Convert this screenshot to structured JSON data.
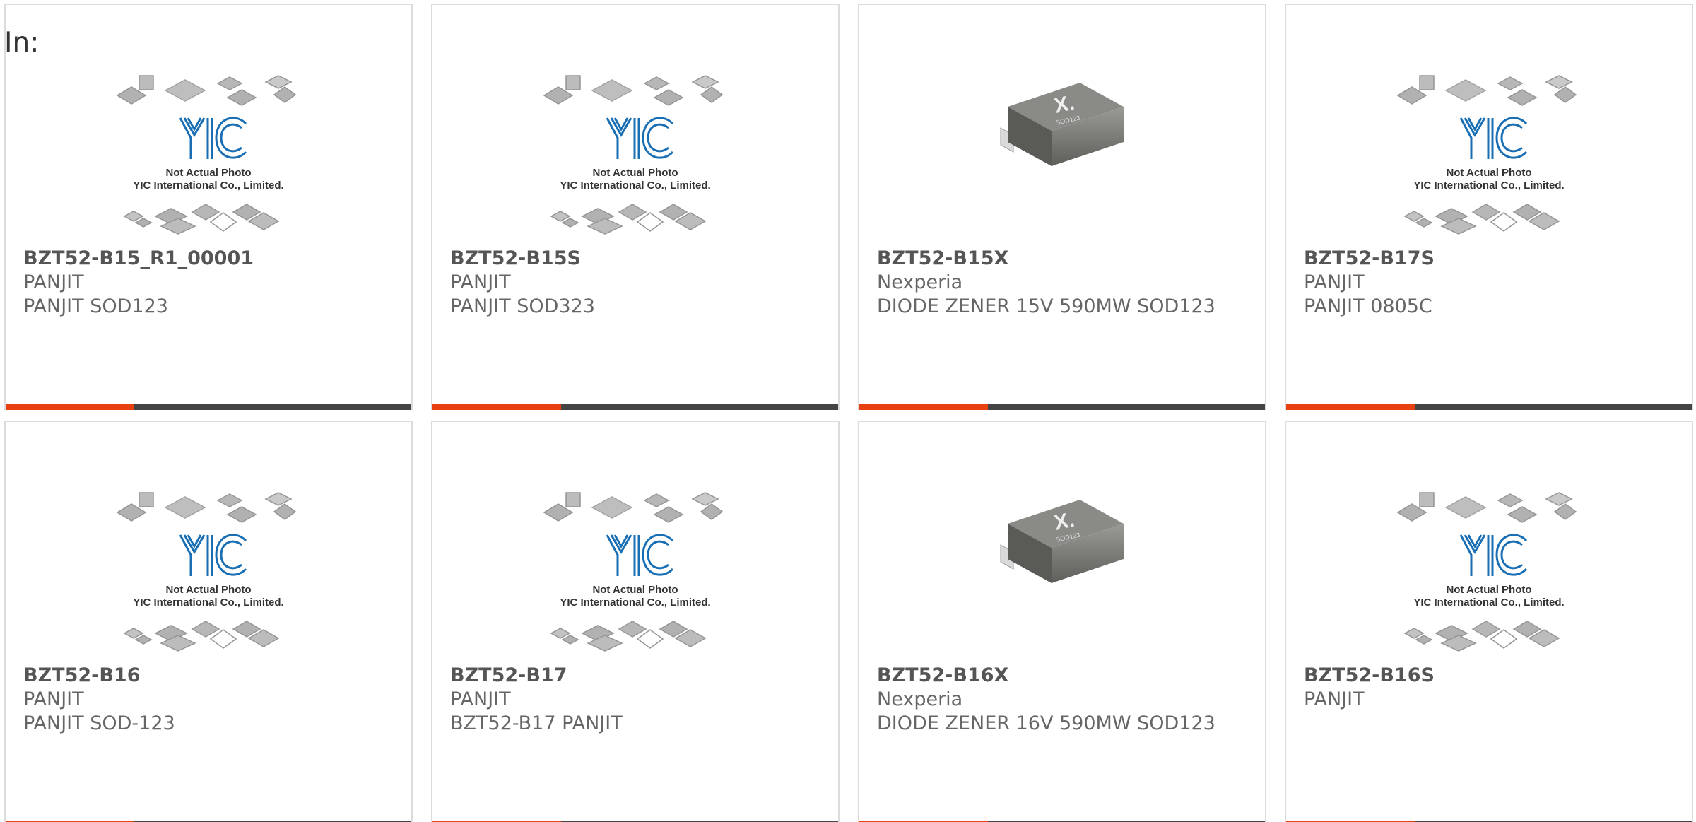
{
  "heading": "In:",
  "placeholder_logo": {
    "brand": "YIC",
    "line1": "Not Actual Photo",
    "line2": "YIC International Co., Limited."
  },
  "chip_photo": {
    "mark": "X.",
    "package": "SOD123"
  },
  "colors": {
    "accent": "#e8400e",
    "bar": "#444444",
    "border": "#dcdcdc",
    "logo_blue": "#1a6fb4"
  },
  "products": [
    {
      "part_number": "BZT52-B15_R1_00001",
      "manufacturer": "PANJIT",
      "description": "PANJIT SOD123",
      "image": "placeholder"
    },
    {
      "part_number": "BZT52-B15S",
      "manufacturer": "PANJIT",
      "description": "PANJIT SOD323",
      "image": "placeholder"
    },
    {
      "part_number": "BZT52-B15X",
      "manufacturer": "Nexperia",
      "description": "DIODE ZENER 15V 590MW SOD123",
      "image": "chip-photo"
    },
    {
      "part_number": "BZT52-B17S",
      "manufacturer": "PANJIT",
      "description": "PANJIT 0805C",
      "image": "placeholder"
    },
    {
      "part_number": "BZT52-B16",
      "manufacturer": "PANJIT",
      "description": "PANJIT SOD-123",
      "image": "placeholder"
    },
    {
      "part_number": "BZT52-B17",
      "manufacturer": "PANJIT",
      "description": "BZT52-B17 PANJIT",
      "image": "placeholder"
    },
    {
      "part_number": "BZT52-B16X",
      "manufacturer": "Nexperia",
      "description": "DIODE ZENER 16V 590MW SOD123",
      "image": "chip-photo"
    },
    {
      "part_number": "BZT52-B16S",
      "manufacturer": "PANJIT",
      "description": "",
      "image": "placeholder"
    }
  ]
}
